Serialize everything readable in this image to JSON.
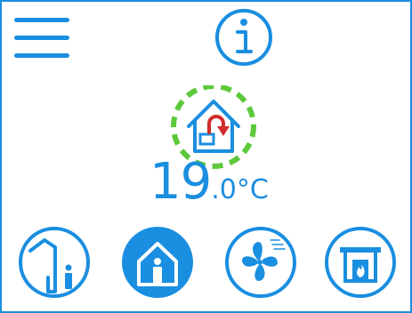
{
  "colors": {
    "primary": "#1a8ee0",
    "highlight": "#5cc93a",
    "accent_red": "#d22b2b",
    "background": "#ffffff"
  },
  "header": {
    "menu_icon": "hamburger-icon",
    "info_icon": "info-icon"
  },
  "mode": {
    "icon": "home-return-icon",
    "highlighted": true
  },
  "temperature": {
    "integer": "19",
    "decimal": ".0",
    "unit": "°C"
  },
  "modes": [
    {
      "icon": "away-icon",
      "active": false
    },
    {
      "icon": "home-icon",
      "active": true
    },
    {
      "icon": "fan-icon",
      "active": false
    },
    {
      "icon": "fireplace-icon",
      "active": false
    }
  ]
}
